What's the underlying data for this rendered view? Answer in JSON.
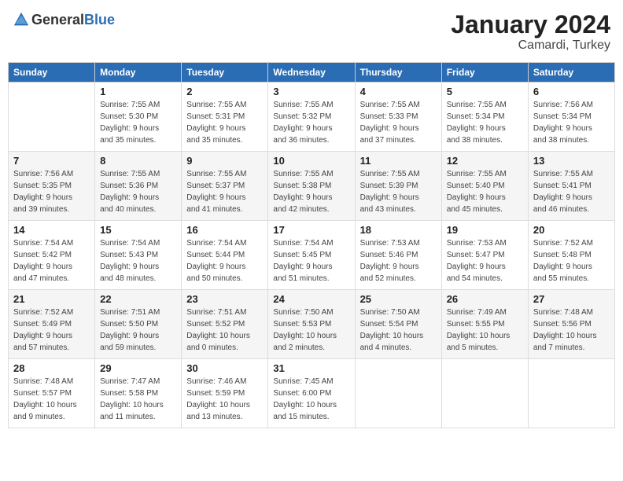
{
  "logo": {
    "text_general": "General",
    "text_blue": "Blue"
  },
  "header": {
    "month": "January 2024",
    "location": "Camardi, Turkey"
  },
  "days_of_week": [
    "Sunday",
    "Monday",
    "Tuesday",
    "Wednesday",
    "Thursday",
    "Friday",
    "Saturday"
  ],
  "weeks": [
    [
      {
        "day": "",
        "info": ""
      },
      {
        "day": "1",
        "info": "Sunrise: 7:55 AM\nSunset: 5:30 PM\nDaylight: 9 hours\nand 35 minutes."
      },
      {
        "day": "2",
        "info": "Sunrise: 7:55 AM\nSunset: 5:31 PM\nDaylight: 9 hours\nand 35 minutes."
      },
      {
        "day": "3",
        "info": "Sunrise: 7:55 AM\nSunset: 5:32 PM\nDaylight: 9 hours\nand 36 minutes."
      },
      {
        "day": "4",
        "info": "Sunrise: 7:55 AM\nSunset: 5:33 PM\nDaylight: 9 hours\nand 37 minutes."
      },
      {
        "day": "5",
        "info": "Sunrise: 7:55 AM\nSunset: 5:34 PM\nDaylight: 9 hours\nand 38 minutes."
      },
      {
        "day": "6",
        "info": "Sunrise: 7:56 AM\nSunset: 5:34 PM\nDaylight: 9 hours\nand 38 minutes."
      }
    ],
    [
      {
        "day": "7",
        "info": "Sunrise: 7:56 AM\nSunset: 5:35 PM\nDaylight: 9 hours\nand 39 minutes."
      },
      {
        "day": "8",
        "info": "Sunrise: 7:55 AM\nSunset: 5:36 PM\nDaylight: 9 hours\nand 40 minutes."
      },
      {
        "day": "9",
        "info": "Sunrise: 7:55 AM\nSunset: 5:37 PM\nDaylight: 9 hours\nand 41 minutes."
      },
      {
        "day": "10",
        "info": "Sunrise: 7:55 AM\nSunset: 5:38 PM\nDaylight: 9 hours\nand 42 minutes."
      },
      {
        "day": "11",
        "info": "Sunrise: 7:55 AM\nSunset: 5:39 PM\nDaylight: 9 hours\nand 43 minutes."
      },
      {
        "day": "12",
        "info": "Sunrise: 7:55 AM\nSunset: 5:40 PM\nDaylight: 9 hours\nand 45 minutes."
      },
      {
        "day": "13",
        "info": "Sunrise: 7:55 AM\nSunset: 5:41 PM\nDaylight: 9 hours\nand 46 minutes."
      }
    ],
    [
      {
        "day": "14",
        "info": "Sunrise: 7:54 AM\nSunset: 5:42 PM\nDaylight: 9 hours\nand 47 minutes."
      },
      {
        "day": "15",
        "info": "Sunrise: 7:54 AM\nSunset: 5:43 PM\nDaylight: 9 hours\nand 48 minutes."
      },
      {
        "day": "16",
        "info": "Sunrise: 7:54 AM\nSunset: 5:44 PM\nDaylight: 9 hours\nand 50 minutes."
      },
      {
        "day": "17",
        "info": "Sunrise: 7:54 AM\nSunset: 5:45 PM\nDaylight: 9 hours\nand 51 minutes."
      },
      {
        "day": "18",
        "info": "Sunrise: 7:53 AM\nSunset: 5:46 PM\nDaylight: 9 hours\nand 52 minutes."
      },
      {
        "day": "19",
        "info": "Sunrise: 7:53 AM\nSunset: 5:47 PM\nDaylight: 9 hours\nand 54 minutes."
      },
      {
        "day": "20",
        "info": "Sunrise: 7:52 AM\nSunset: 5:48 PM\nDaylight: 9 hours\nand 55 minutes."
      }
    ],
    [
      {
        "day": "21",
        "info": "Sunrise: 7:52 AM\nSunset: 5:49 PM\nDaylight: 9 hours\nand 57 minutes."
      },
      {
        "day": "22",
        "info": "Sunrise: 7:51 AM\nSunset: 5:50 PM\nDaylight: 9 hours\nand 59 minutes."
      },
      {
        "day": "23",
        "info": "Sunrise: 7:51 AM\nSunset: 5:52 PM\nDaylight: 10 hours\nand 0 minutes."
      },
      {
        "day": "24",
        "info": "Sunrise: 7:50 AM\nSunset: 5:53 PM\nDaylight: 10 hours\nand 2 minutes."
      },
      {
        "day": "25",
        "info": "Sunrise: 7:50 AM\nSunset: 5:54 PM\nDaylight: 10 hours\nand 4 minutes."
      },
      {
        "day": "26",
        "info": "Sunrise: 7:49 AM\nSunset: 5:55 PM\nDaylight: 10 hours\nand 5 minutes."
      },
      {
        "day": "27",
        "info": "Sunrise: 7:48 AM\nSunset: 5:56 PM\nDaylight: 10 hours\nand 7 minutes."
      }
    ],
    [
      {
        "day": "28",
        "info": "Sunrise: 7:48 AM\nSunset: 5:57 PM\nDaylight: 10 hours\nand 9 minutes."
      },
      {
        "day": "29",
        "info": "Sunrise: 7:47 AM\nSunset: 5:58 PM\nDaylight: 10 hours\nand 11 minutes."
      },
      {
        "day": "30",
        "info": "Sunrise: 7:46 AM\nSunset: 5:59 PM\nDaylight: 10 hours\nand 13 minutes."
      },
      {
        "day": "31",
        "info": "Sunrise: 7:45 AM\nSunset: 6:00 PM\nDaylight: 10 hours\nand 15 minutes."
      },
      {
        "day": "",
        "info": ""
      },
      {
        "day": "",
        "info": ""
      },
      {
        "day": "",
        "info": ""
      }
    ]
  ]
}
